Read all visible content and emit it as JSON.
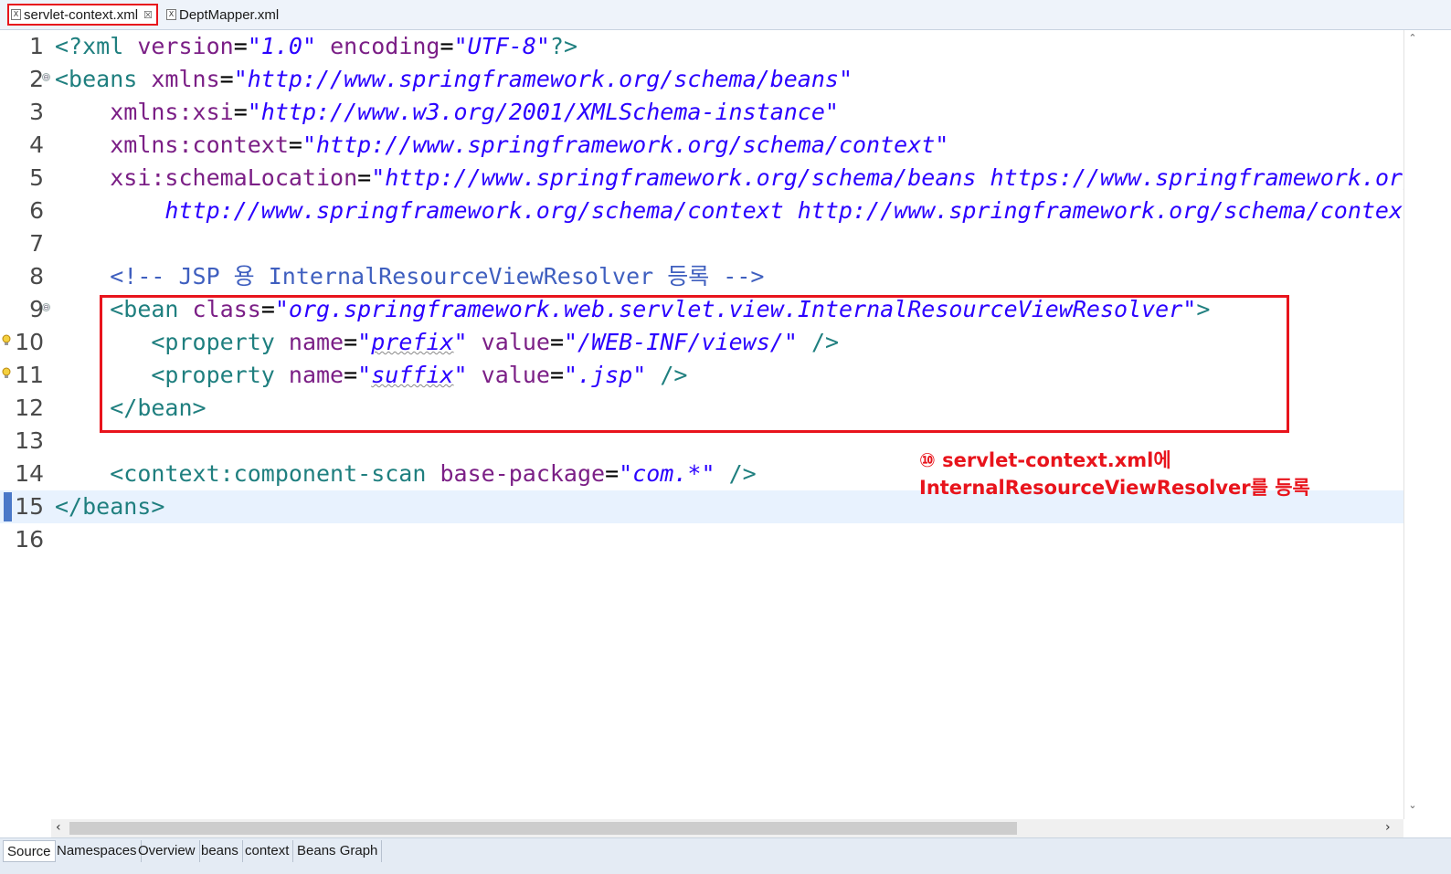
{
  "tabs": [
    {
      "label": "servlet-context.xml",
      "close": "☒"
    },
    {
      "label": "DeptMapper.xml"
    }
  ],
  "tab_icon": "X",
  "lines": [
    {
      "n": "1"
    },
    {
      "n": "2"
    },
    {
      "n": "3"
    },
    {
      "n": "4"
    },
    {
      "n": "5"
    },
    {
      "n": "6"
    },
    {
      "n": "7"
    },
    {
      "n": "8"
    },
    {
      "n": "9"
    },
    {
      "n": "10"
    },
    {
      "n": "11"
    },
    {
      "n": "12"
    },
    {
      "n": "13"
    },
    {
      "n": "14"
    },
    {
      "n": "15"
    },
    {
      "n": "16"
    }
  ],
  "code": {
    "l1": {
      "open": "<?xml",
      "a1": "version",
      "v1": "\"1.0\"",
      "a2": "encoding",
      "v2": "\"UTF-8\"",
      "close": "?>"
    },
    "l2": {
      "open": "<beans",
      "a1": "xmlns",
      "v1": "\"http://www.springframework.org/schema/beans\""
    },
    "l3": {
      "a1": "xmlns:xsi",
      "v1": "\"http://www.w3.org/2001/XMLSchema-instance\""
    },
    "l4": {
      "a1": "xmlns:context",
      "v1": "\"http://www.springframework.org/schema/context\""
    },
    "l5": {
      "a1": "xsi:schemaLocation",
      "v1": "\"http://www.springframework.org/schema/beans https://www.springframework.org/schema/beans/spring-beans.xsd"
    },
    "l6": {
      "v1": "http://www.springframework.org/schema/context http://www.springframework.org/schema/context/spring-context.xsd\">"
    },
    "l8": {
      "comment": "<!-- JSP 용 InternalResourceViewResolver 등록 -->"
    },
    "l9": {
      "open": "<bean",
      "a1": "class",
      "v1": "\"org.springframework.web.servlet.view.InternalResourceViewResolver\"",
      "close": ">"
    },
    "l10": {
      "open": "<property",
      "a1": "name",
      "v1a": "\"",
      "v1b": "prefix",
      "v1c": "\"",
      "a2": "value",
      "v2": "\"/WEB-INF/views/\"",
      "close": "/>"
    },
    "l11": {
      "open": "<property",
      "a1": "name",
      "v1a": "\"",
      "v1b": "suffix",
      "v1c": "\"",
      "a2": "value",
      "v2": "\".jsp\"",
      "close": "/>"
    },
    "l12": {
      "close": "</bean>"
    },
    "l14": {
      "open": "<context:component-scan",
      "a1": "base-package",
      "v1": "\"com.*\"",
      "close": "/>"
    },
    "l15": {
      "close": "</beans>"
    }
  },
  "fold_glyph": "⊖",
  "annotation": {
    "line1": "⑩ servlet-context.xml에",
    "line2": "InternalResourceViewResolver를 등록"
  },
  "scroll": {
    "up": "⌃",
    "down": "⌄",
    "left": "‹",
    "right": "›"
  },
  "bottom_tabs": [
    "Source",
    "Namespaces",
    "Overview",
    "beans",
    "context",
    "Beans Graph"
  ],
  "colors": {
    "tag": "#1f7f7f",
    "attribute": "#7b1f86",
    "string": "#2a00ff",
    "comment": "#3f5fbf",
    "highlight": "#e8141c"
  }
}
